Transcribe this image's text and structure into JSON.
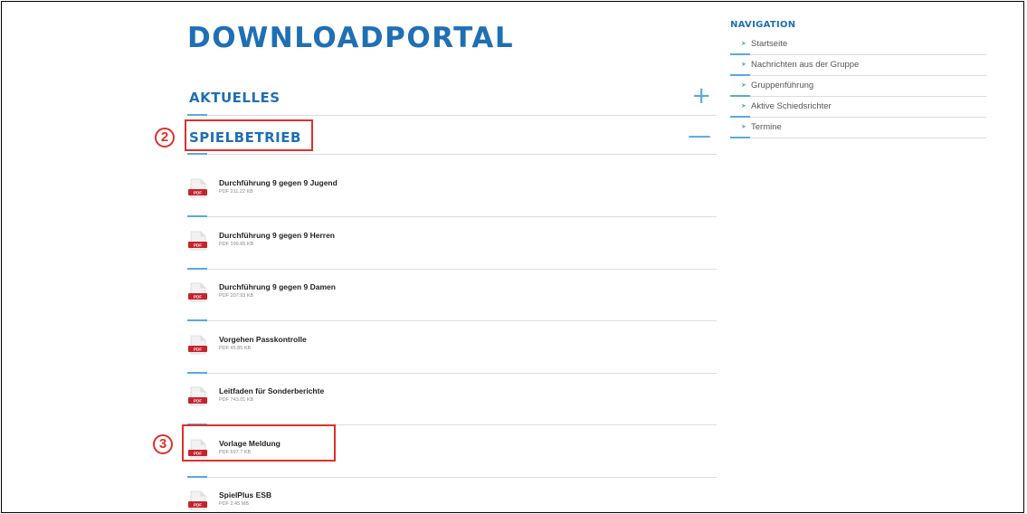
{
  "main": {
    "page_title": "DOWNLOADPORTAL",
    "sections": [
      {
        "title": "AKTUELLES",
        "toggle": "+"
      },
      {
        "title": "SPIELBETRIEB",
        "toggle": "—"
      }
    ],
    "downloads": [
      {
        "name": "Durchführung 9 gegen 9 Jugend",
        "meta": "PDF 211.22 KB"
      },
      {
        "name": "Durchführung 9 gegen 9 Herren",
        "meta": "PDF 199.65 KB"
      },
      {
        "name": "Durchführung 9 gegen 9 Damen",
        "meta": "PDF 207.93 KB"
      },
      {
        "name": "Vorgehen Passkontrolle",
        "meta": "PDF 45.85 KB"
      },
      {
        "name": "Leitfaden für Sonderberichte",
        "meta": "PDF 743.01 KB"
      },
      {
        "name": "Vorlage Meldung",
        "meta": "PDF 697.7 KB"
      },
      {
        "name": "SpielPlus ESB",
        "meta": "PDF 2.45 MB"
      }
    ],
    "icon": "pdf-file-icon",
    "icon_label": "PDF"
  },
  "nav": {
    "title": "NAVIGATION",
    "arrow_icon": "arrow-right-icon",
    "items": [
      {
        "label": "Startseite"
      },
      {
        "label": "Nachrichten aus der Gruppe"
      },
      {
        "label": "Gruppenführung"
      },
      {
        "label": "Aktive Schiedsrichter"
      },
      {
        "label": "Termine"
      }
    ]
  },
  "annotations": [
    {
      "number": "2"
    },
    {
      "number": "3"
    }
  ],
  "colors": {
    "brand": "#1f6fb5",
    "accent": "#5aa9e0",
    "callout": "#e0302a",
    "pdf_red": "#c8232c"
  }
}
